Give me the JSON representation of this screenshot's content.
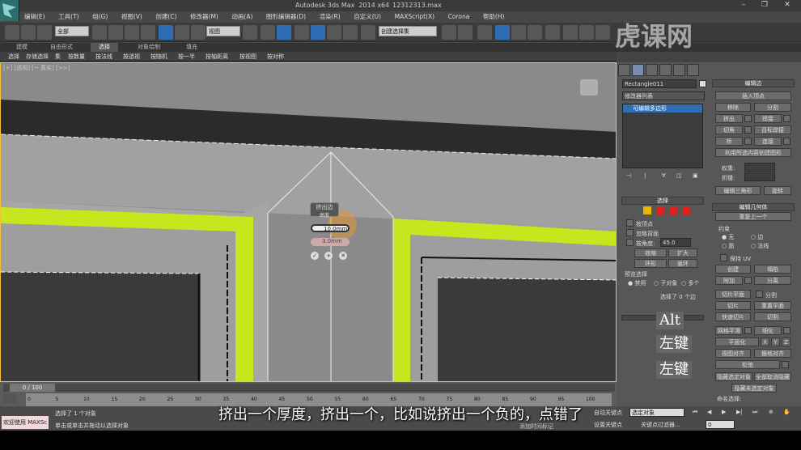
{
  "app": {
    "title": "Autodesk 3ds Max  2014 x64",
    "file": "12312313.max"
  },
  "menu": [
    "编辑(E)",
    "工具(T)",
    "组(G)",
    "视图(V)",
    "创建(C)",
    "修改器(M)",
    "动画(A)",
    "图形编辑器(D)",
    "渲染(R)",
    "自定义(U)",
    "MAXScript(X)",
    "Corona",
    "帮助(H)"
  ],
  "toolbar": {
    "filter_value": "全部",
    "view_value": "视图",
    "selset_value": "创建选择集"
  },
  "ribbon": {
    "tabs": [
      "建模",
      "自由形式",
      "选择",
      "对象绘制",
      "填充"
    ],
    "tools": [
      "选择",
      "存储选择",
      "集",
      "按数量",
      "按法线",
      "按透视",
      "按随机",
      "按一半",
      "按轴距离",
      "按视图",
      "按对称"
    ]
  },
  "viewport": {
    "label": "[+] [透视] [~ 真实] [>>]"
  },
  "caddy": {
    "title": "挤出边",
    "mode": "高度",
    "height": "10.0mm",
    "width": "3.0mm"
  },
  "command_panel": {
    "object_name": "Rectangle011",
    "modifier_list": "修改器列表",
    "stack_item": "可编辑多边形",
    "edit_edges": {
      "header": "编辑边",
      "insert_vertex": "插入顶点",
      "remove": "移除",
      "split": "分割",
      "extrude": "挤出",
      "weld": "焊接",
      "chamfer": "切角",
      "target_weld": "目标焊接",
      "bridge": "桥",
      "connect": "连接",
      "create_shape": "利用所选内容创建图形",
      "weight_label": "权重:",
      "crease_label": "折缝:",
      "edit_tri": "编辑三角形",
      "turn": "旋转"
    },
    "selection": {
      "header": "选择",
      "by_vertex": "按顶点",
      "ignore_backface": "忽略背面",
      "by_angle": "按角度:",
      "angle_value": "45.0",
      "shrink": "收缩",
      "grow": "扩大",
      "ring": "环形",
      "loop": "循环",
      "preview_label": "预览选择",
      "off": "禁用",
      "subobj": "子对象",
      "multi": "多个",
      "status": "选择了 0 个边"
    },
    "edit_geometry": {
      "header": "编辑几何体",
      "repeat_last": "重复上一个",
      "constraints": "约束",
      "none": "无",
      "edge": "边",
      "face": "面",
      "normal": "法线",
      "preserve_uv": "保持 UV",
      "create": "创建",
      "collapse": "塌陷",
      "attach": "附加",
      "detach": "分离",
      "slice_plane": "切片平面",
      "split": "分割",
      "slice": "切片",
      "reset_plane": "重置平面",
      "quick_slice": "快速切片",
      "cut": "切割",
      "meshsmooth": "网格平滑",
      "tessellate": "细化",
      "make_planar": "平面化",
      "x": "X",
      "y": "Y",
      "z": "Z",
      "view_align": "视图对齐",
      "grid_align": "栅格对齐",
      "relax": "松弛",
      "hide_selected": "隐藏选定对象",
      "unhide_all": "全部取消隐藏",
      "hide_unselected": "隐藏未选定对象",
      "named_sel": "命名选择:"
    }
  },
  "keys": {
    "alt": "Alt",
    "lmb1": "左键",
    "lmb2": "左键"
  },
  "timeline": {
    "frame": "0 / 100",
    "ticks": [
      "0",
      "5",
      "10",
      "15",
      "20",
      "25",
      "30",
      "35",
      "40",
      "45",
      "50",
      "55",
      "60",
      "65",
      "70",
      "75",
      "80",
      "85",
      "90",
      "95",
      "100"
    ]
  },
  "status": {
    "welcome": "欢迎使用 MAXSc",
    "line1": "选择了 1 个对象",
    "line2": "单击或单击并拖动以选择对象",
    "autokey": "自动关键点",
    "setkey": "设置关键点",
    "selected": "选定对象",
    "keyfilter": "关键点过滤器...",
    "add_tag": "添加时间标记",
    "frame": "0"
  },
  "subtitle": "挤出一个厚度，挤出一个，比如说挤出一个负的，点错了",
  "watermark": "虎课网",
  "colors": {
    "selection_yellow": "#c8e61e",
    "accent_blue": "#2f6db5"
  }
}
